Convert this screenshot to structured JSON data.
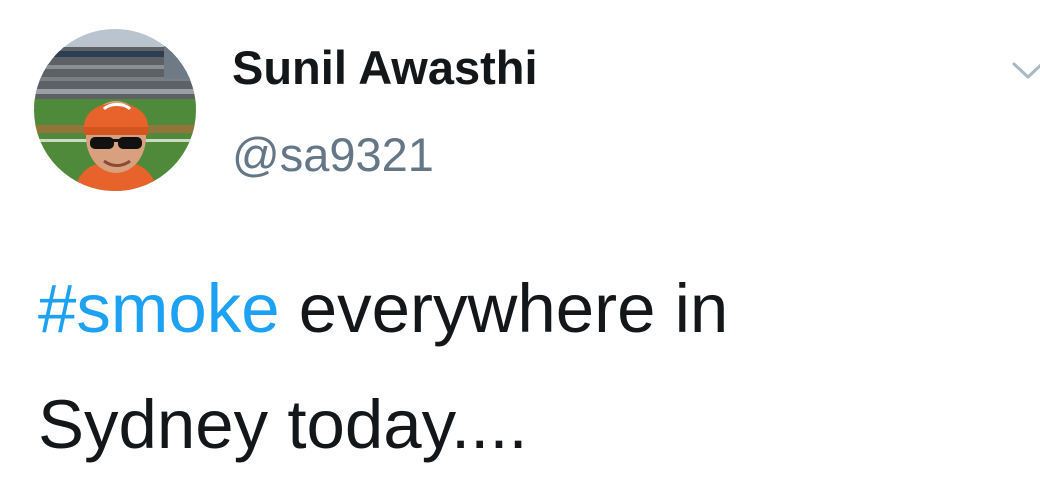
{
  "tweet": {
    "author": {
      "display_name": "Sunil Awasthi",
      "handle": "@sa9321"
    },
    "text": {
      "hashtag": "#smoke",
      "body_line1": " everywhere in",
      "body_line2": "Sydney today...."
    },
    "menu_icon": "chevron-down-icon"
  },
  "colors": {
    "hashtag": "#1da1f2",
    "handle": "#657786",
    "text": "#14171a"
  }
}
